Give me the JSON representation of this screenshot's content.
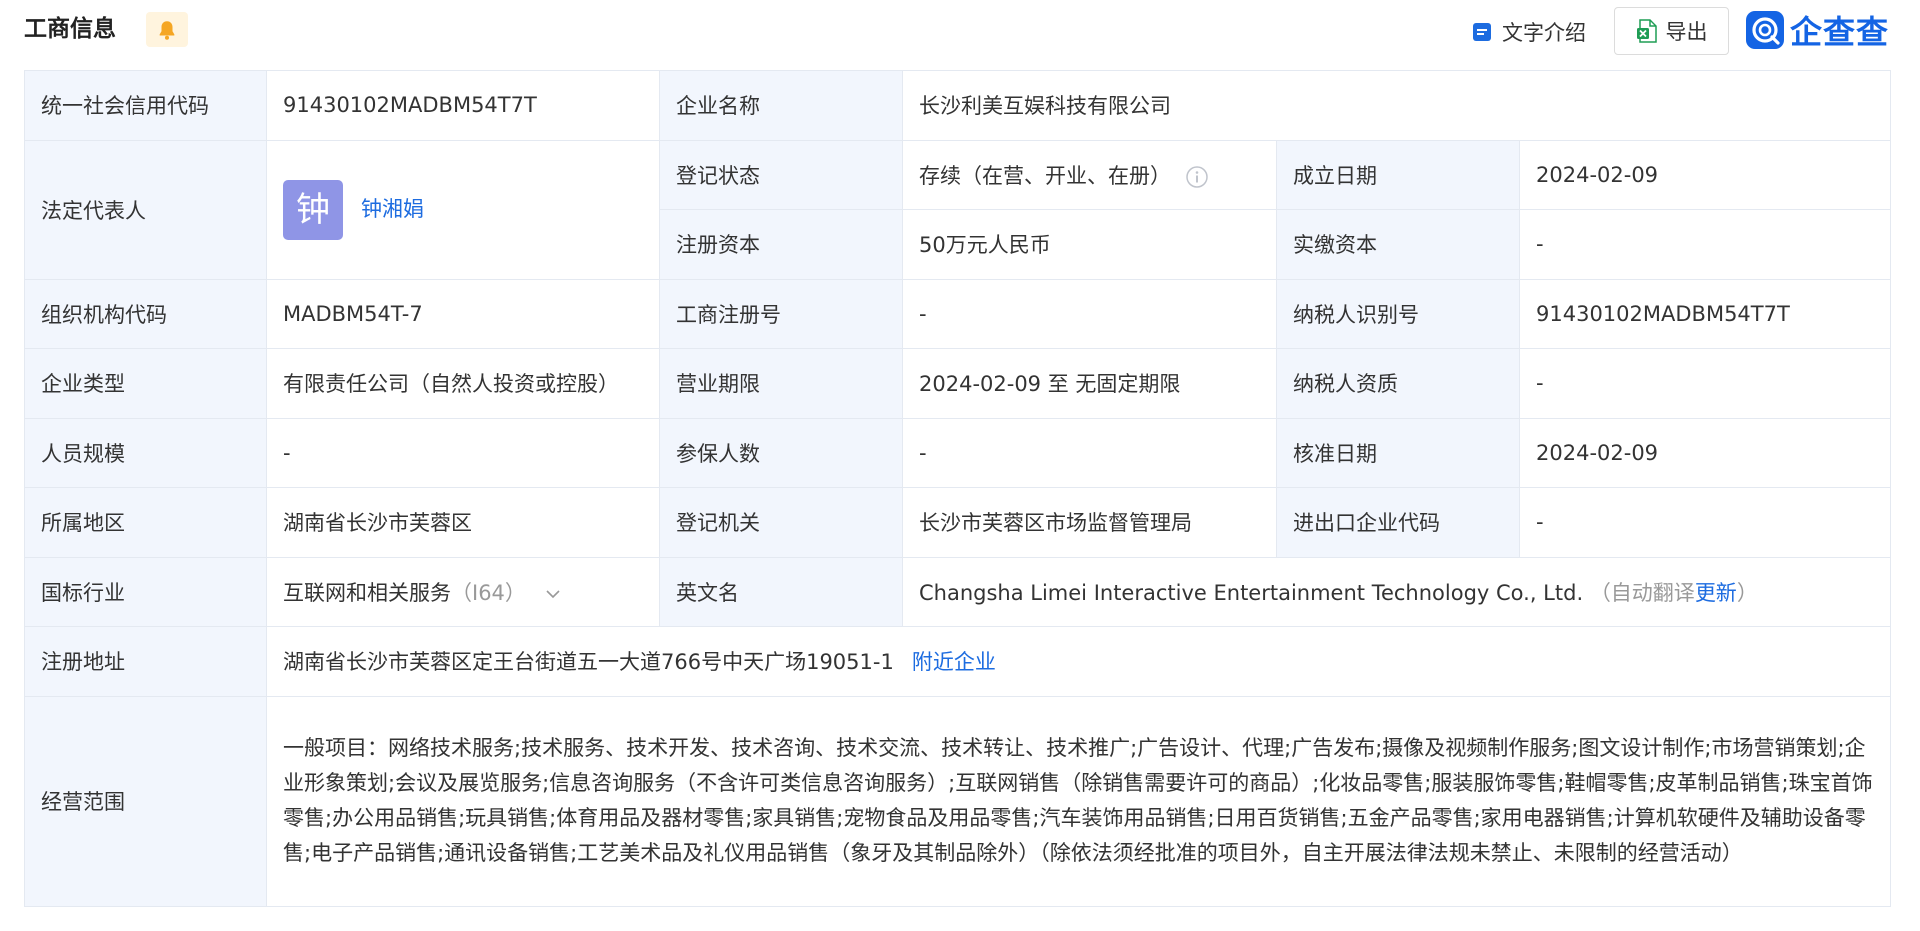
{
  "header": {
    "title": "工商信息",
    "text_intro_label": "文字介绍",
    "export_label": "导出",
    "brand_name": "企查查",
    "icons": {
      "bell": "bell-icon",
      "text_intro": "document-icon",
      "export": "excel-icon",
      "brand": "brand-logo-icon"
    }
  },
  "labels": {
    "credit_code": "统一社会信用代码",
    "company_name": "企业名称",
    "legal_rep": "法定代表人",
    "reg_status": "登记状态",
    "established": "成立日期",
    "reg_capital": "注册资本",
    "paid_capital": "实缴资本",
    "org_code": "组织机构代码",
    "biz_reg_no": "工商注册号",
    "taxpayer_id": "纳税人识别号",
    "company_type": "企业类型",
    "biz_term": "营业期限",
    "taxpayer_qual": "纳税人资质",
    "staff_size": "人员规模",
    "insured_count": "参保人数",
    "approval_date": "核准日期",
    "region": "所属地区",
    "reg_authority": "登记机关",
    "import_export_code": "进出口企业代码",
    "industry": "国标行业",
    "english_name": "英文名",
    "reg_address": "注册地址",
    "business_scope": "经营范围"
  },
  "values": {
    "credit_code": "91430102MADBM54T7T",
    "company_name": "长沙利美互娱科技有限公司",
    "legal_rep_avatar": "钟",
    "legal_rep_name": "钟湘娟",
    "reg_status": "存续（在营、开业、在册）",
    "established": "2024-02-09",
    "reg_capital": "50万元人民币",
    "paid_capital": "-",
    "org_code": "MADBM54T-7",
    "biz_reg_no": "-",
    "taxpayer_id": "91430102MADBM54T7T",
    "company_type": "有限责任公司（自然人投资或控股）",
    "biz_term": "2024-02-09 至 无固定期限",
    "taxpayer_qual": "-",
    "staff_size": "-",
    "insured_count": "-",
    "approval_date": "2024-02-09",
    "region": "湖南省长沙市芙蓉区",
    "reg_authority": "长沙市芙蓉区市场监督管理局",
    "import_export_code": "-",
    "industry_name": "互联网和相关服务",
    "industry_code": "（I64）",
    "english_name": "Changsha Limei Interactive Entertainment Technology Co., Ltd.",
    "english_note_open": "（自动翻译",
    "english_update": "更新",
    "english_note_close": "）",
    "reg_address": "湖南省长沙市芙蓉区定王台街道五一大道766号中天广场19051-1",
    "nearby_link": "附近企业",
    "business_scope": "一般项目：网络技术服务;技术服务、技术开发、技术咨询、技术交流、技术转让、技术推广;广告设计、代理;广告发布;摄像及视频制作服务;图文设计制作;市场营销策划;企业形象策划;会议及展览服务;信息咨询服务（不含许可类信息咨询服务）;互联网销售（除销售需要许可的商品）;化妆品零售;服装服饰零售;鞋帽零售;皮革制品销售;珠宝首饰零售;办公用品销售;玩具销售;体育用品及器材零售;家具销售;宠物食品及用品零售;汽车装饰用品销售;日用百货销售;五金产品零售;家用电器销售;计算机软硬件及辅助设备零售;电子产品销售;通讯设备销售;工艺美术品及礼仪用品销售（象牙及其制品除外）（除依法须经批准的项目外，自主开展法律法规未禁止、未限制的经营活动）"
  },
  "colors": {
    "label_bg": "#f2f6fd",
    "border": "#e4e9f1",
    "link": "#1d6ce0",
    "avatar_bg": "#8f95e6",
    "bell": "#f5a623",
    "brand": "#1464e4"
  }
}
